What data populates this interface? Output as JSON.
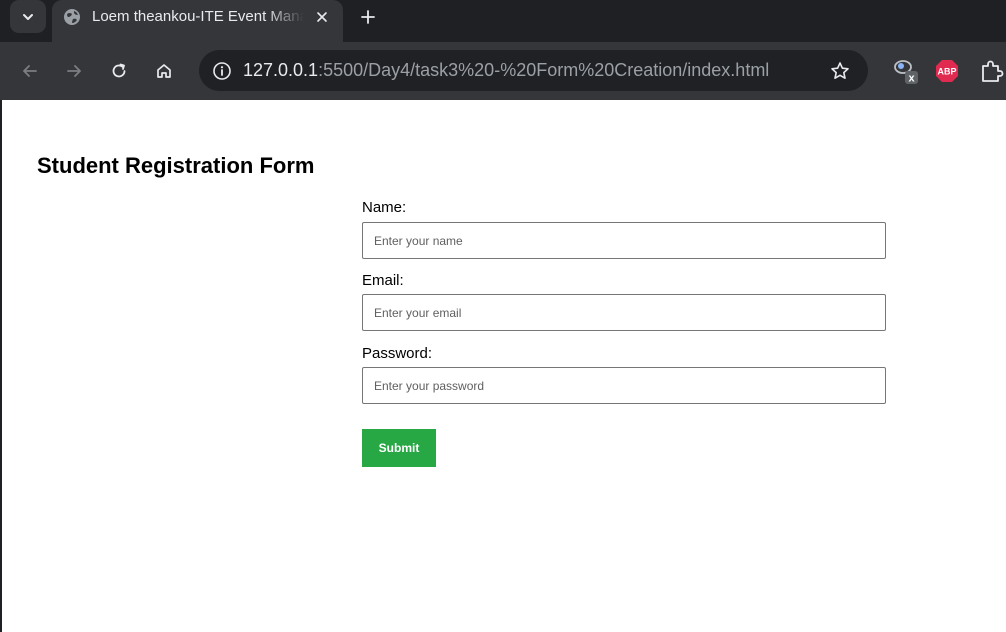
{
  "browser": {
    "tab": {
      "title": "Loem theankou-ITE Event Management"
    },
    "address_bar": {
      "url_host": "127.0.0.1",
      "url_rest": ":5500/Day4/task3%20-%20Form%20Creation/index.html"
    },
    "extensions": [
      {
        "name": "extension-x-icon",
        "badge": "x"
      },
      {
        "name": "adblock-plus-icon",
        "badge": "ABP"
      }
    ],
    "colors": {
      "tabstrip": "#1f2023",
      "toolbar": "#35363a",
      "omnibox": "#202124"
    }
  },
  "page": {
    "title": "Student Registration Form",
    "form": {
      "name_label": "Name:",
      "name_placeholder": "Enter your name",
      "email_label": "Email:",
      "email_placeholder": "Enter your email",
      "password_label": "Password:",
      "password_placeholder": "Enter your password",
      "submit_label": "Submit"
    },
    "colors": {
      "submit_button": "#28a745"
    }
  }
}
